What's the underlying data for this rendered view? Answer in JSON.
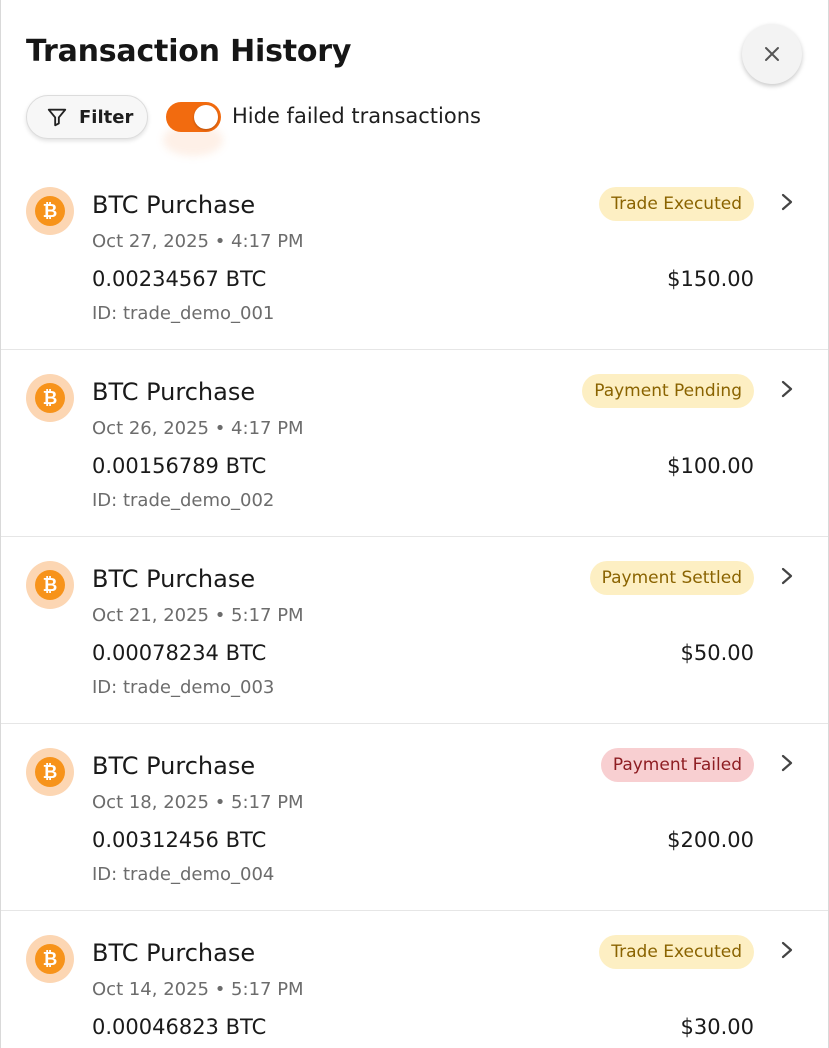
{
  "header": {
    "title": "Transaction History",
    "close_icon": "close-icon"
  },
  "toolbar": {
    "filter_label": "Filter",
    "filter_icon": "filter-icon",
    "toggle_label": "Hide failed transactions",
    "toggle_on": true
  },
  "colors": {
    "accent": "#f26b0f",
    "bitcoin": "#f7931a",
    "status_ok_bg": "#fdefc3",
    "status_fail_bg": "#f8cfd1"
  },
  "transactions": [
    {
      "name": "BTC Purchase",
      "date": "Oct 27, 2025 • 4:17 PM",
      "amount": "0.00234567 BTC",
      "id": "ID: trade_demo_001",
      "status": "Trade Executed",
      "status_type": "ok",
      "price": "$150.00"
    },
    {
      "name": "BTC Purchase",
      "date": "Oct 26, 2025 • 4:17 PM",
      "amount": "0.00156789 BTC",
      "id": "ID: trade_demo_002",
      "status": "Payment Pending",
      "status_type": "ok",
      "price": "$100.00"
    },
    {
      "name": "BTC Purchase",
      "date": "Oct 21, 2025 • 5:17 PM",
      "amount": "0.00078234 BTC",
      "id": "ID: trade_demo_003",
      "status": "Payment Settled",
      "status_type": "ok",
      "price": "$50.00"
    },
    {
      "name": "BTC Purchase",
      "date": "Oct 18, 2025 • 5:17 PM",
      "amount": "0.00312456 BTC",
      "id": "ID: trade_demo_004",
      "status": "Payment Failed",
      "status_type": "fail",
      "price": "$200.00"
    },
    {
      "name": "BTC Purchase",
      "date": "Oct 14, 2025 • 5:17 PM",
      "amount": "0.00046823 BTC",
      "id": "",
      "status": "Trade Executed",
      "status_type": "ok",
      "price": "$30.00"
    }
  ]
}
